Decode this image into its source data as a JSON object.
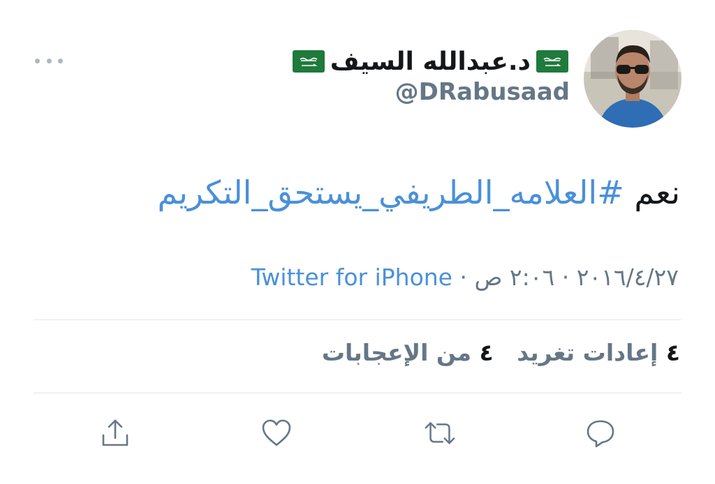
{
  "user": {
    "display_name": "د.عبدالله السيف",
    "handle": "@DRabusaad",
    "flag_icon": "saudi-flag-icon"
  },
  "tweet": {
    "text_prefix": "نعم",
    "hashtag": "#العلامه_الطريفي_يستحق_التكريم"
  },
  "meta": {
    "date": "٢٠١٦/٤/٢٧",
    "separator": "·",
    "time": "٢:٠٦ ص",
    "source": "Twitter for iPhone"
  },
  "stats": {
    "retweets_count": "٤",
    "retweets_label": "إعادات تغريد",
    "likes_count": "٤",
    "likes_label": "من الإعجابات"
  },
  "actions": [
    {
      "icon": "reply-icon"
    },
    {
      "icon": "retweet-icon"
    },
    {
      "icon": "like-icon"
    },
    {
      "icon": "share-icon"
    }
  ],
  "colors": {
    "link": "#4a90d9",
    "secondary_text": "#657786",
    "icon": "#657786",
    "divider": "#e1e8ed",
    "flag_green": "#1f7a3c"
  }
}
